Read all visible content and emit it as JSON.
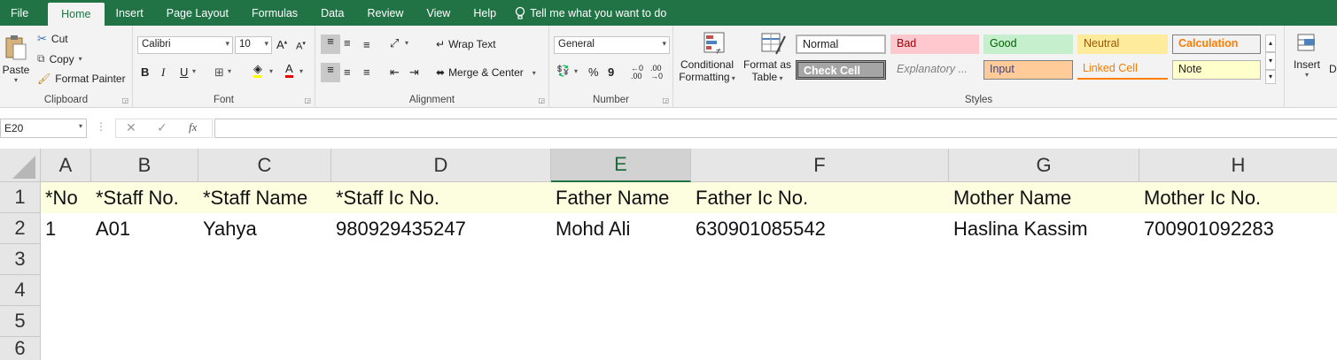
{
  "menu": {
    "tabs": [
      "File",
      "Home",
      "Insert",
      "Page Layout",
      "Formulas",
      "Data",
      "Review",
      "View",
      "Help"
    ],
    "tell_me": "Tell me what you want to do"
  },
  "ribbon": {
    "clipboard": {
      "paste": "Paste",
      "cut": "Cut",
      "copy": "Copy",
      "format_painter": "Format Painter",
      "label": "Clipboard"
    },
    "font": {
      "font_name": "Calibri",
      "font_size": "10",
      "bold": "B",
      "italic": "I",
      "underline": "U",
      "label": "Font"
    },
    "alignment": {
      "wrap_text": "Wrap Text",
      "merge_center": "Merge & Center",
      "label": "Alignment"
    },
    "number": {
      "format": "General",
      "percent": "%",
      "comma": "9",
      "label": "Number"
    },
    "styles": {
      "conditional_1": "Conditional",
      "conditional_2": "Formatting",
      "format_as_1": "Format as",
      "format_as_2": "Table",
      "cells": {
        "normal": "Normal",
        "bad": "Bad",
        "good": "Good",
        "neutral": "Neutral",
        "calculation": "Calculation",
        "check_cell": "Check Cell",
        "explanatory": "Explanatory ...",
        "input": "Input",
        "linked_cell": "Linked Cell",
        "note": "Note"
      },
      "label": "Styles"
    },
    "cells": {
      "insert": "Insert",
      "delete_partial": "D"
    }
  },
  "formula_bar": {
    "name_box": "E20",
    "fx": "fx",
    "value": ""
  },
  "grid": {
    "columns": [
      "A",
      "B",
      "C",
      "D",
      "E",
      "F",
      "G",
      "H"
    ],
    "selected_column": "E",
    "row_numbers": [
      "1",
      "2",
      "3",
      "4",
      "5",
      "6"
    ],
    "rows": [
      [
        "*No",
        "*Staff No.",
        "*Staff Name",
        "*Staff Ic No.",
        "Father Name",
        "Father Ic No.",
        "Mother Name",
        "Mother Ic No."
      ],
      [
        "1",
        "A01",
        "Yahya",
        "980929435247",
        "Mohd Ali",
        "630901085542",
        "Haslina Kassim",
        "700901092283"
      ]
    ]
  },
  "colors": {
    "excel_green": "#217346",
    "header_row_fill": "#fdfde0",
    "bad_fill": "#ffc7ce",
    "good_fill": "#c6efce",
    "neutral_fill": "#ffeb9c",
    "input_fill": "#ffcc99",
    "note_fill": "#ffffcc"
  }
}
